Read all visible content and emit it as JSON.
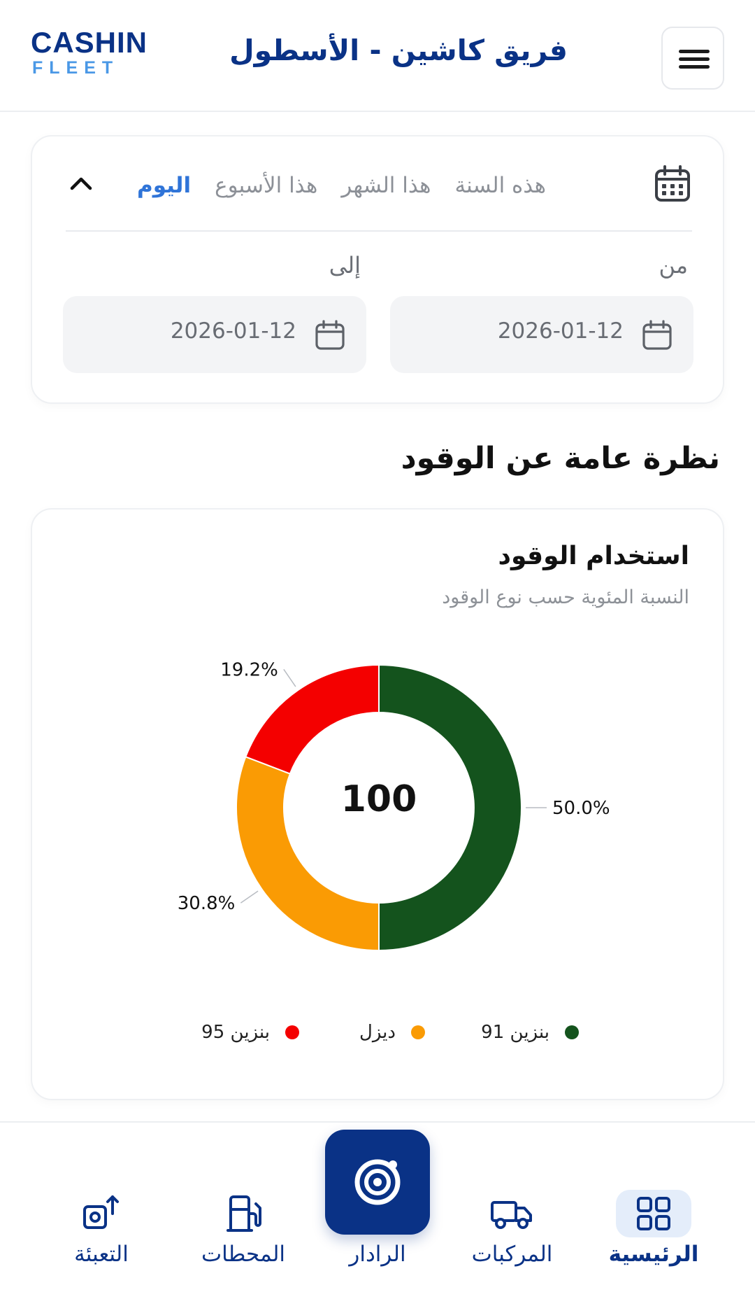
{
  "header": {
    "logo_main": "CASHIN",
    "logo_sub": "FLEET",
    "title": "فريق كاشين - الأسطول"
  },
  "filter": {
    "tabs": [
      {
        "label": "اليوم",
        "active": true
      },
      {
        "label": "هذا الأسبوع",
        "active": false
      },
      {
        "label": "هذا الشهر",
        "active": false
      },
      {
        "label": "هذه السنة",
        "active": false
      }
    ],
    "from_label": "من",
    "to_label": "إلى",
    "from_date": "2026-01-12",
    "to_date": "2026-01-12"
  },
  "section_title": "نظرة عامة عن الوقود",
  "chart_card": {
    "title": "استخدام الوقود",
    "subtitle": "النسبة المئوية حسب نوع الوقود",
    "center_value": "100"
  },
  "chart_data": {
    "type": "pie",
    "donut": true,
    "categories": [
      "بنزين 91",
      "ديزل",
      "بنزين 95"
    ],
    "values": [
      50.0,
      30.8,
      19.2
    ],
    "labels": [
      "50.0%",
      "30.8%",
      "19.2%"
    ],
    "colors": [
      "#14531d",
      "#fa9b04",
      "#f40000"
    ],
    "legend_position": "bottom"
  },
  "nav": {
    "items": [
      {
        "label": "الرئيسية",
        "icon": "grid-icon",
        "active": true
      },
      {
        "label": "المركبات",
        "icon": "truck-icon",
        "active": false
      },
      {
        "label": "الرادار",
        "icon": "radar-icon",
        "active": false
      },
      {
        "label": "المحطات",
        "icon": "fuel-pump-icon",
        "active": false
      },
      {
        "label": "التعبئة",
        "icon": "refuel-icon",
        "active": false
      }
    ]
  }
}
